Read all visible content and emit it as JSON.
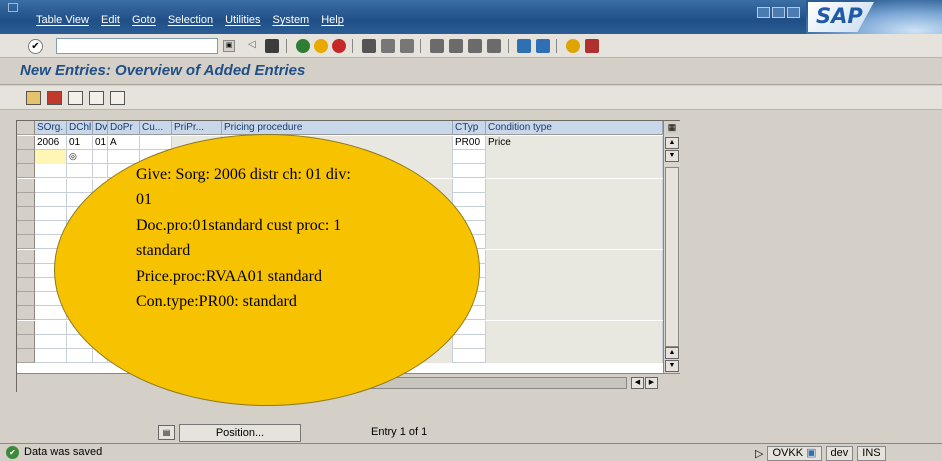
{
  "menubar": {
    "items": [
      "Table View",
      "Edit",
      "Goto",
      "Selection",
      "Utilities",
      "System",
      "Help"
    ],
    "logo": "SAP"
  },
  "toolbar": {
    "command_value": ""
  },
  "screen": {
    "title": "New Entries: Overview of Added Entries"
  },
  "table": {
    "columns": [
      "SOrg.",
      "DChl",
      "Dv",
      "DoPr",
      "Cu...",
      "PriPr...",
      "Pricing procedure",
      "CTyp",
      "Condition type"
    ],
    "rows": [
      {
        "sorg": "2006",
        "dchl": "01",
        "dv": "01",
        "dopr": "A",
        "ctyp": "PR00",
        "condition_type": "Price"
      }
    ]
  },
  "callout": {
    "lines": [
      "Give: Sorg: 2006 distr ch: 01 div:",
      "01",
      "Doc.pro:01standard cust proc: 1",
      "standard",
      "Price.proc:RVAA01 standard",
      "Con.type:PR00: standard"
    ]
  },
  "bottom": {
    "position_button": "Position...",
    "entry_info": "Entry 1 of 1"
  },
  "statusbar": {
    "message": "Data was saved",
    "transaction": "OVKK",
    "system": "dev",
    "mode": "INS"
  }
}
